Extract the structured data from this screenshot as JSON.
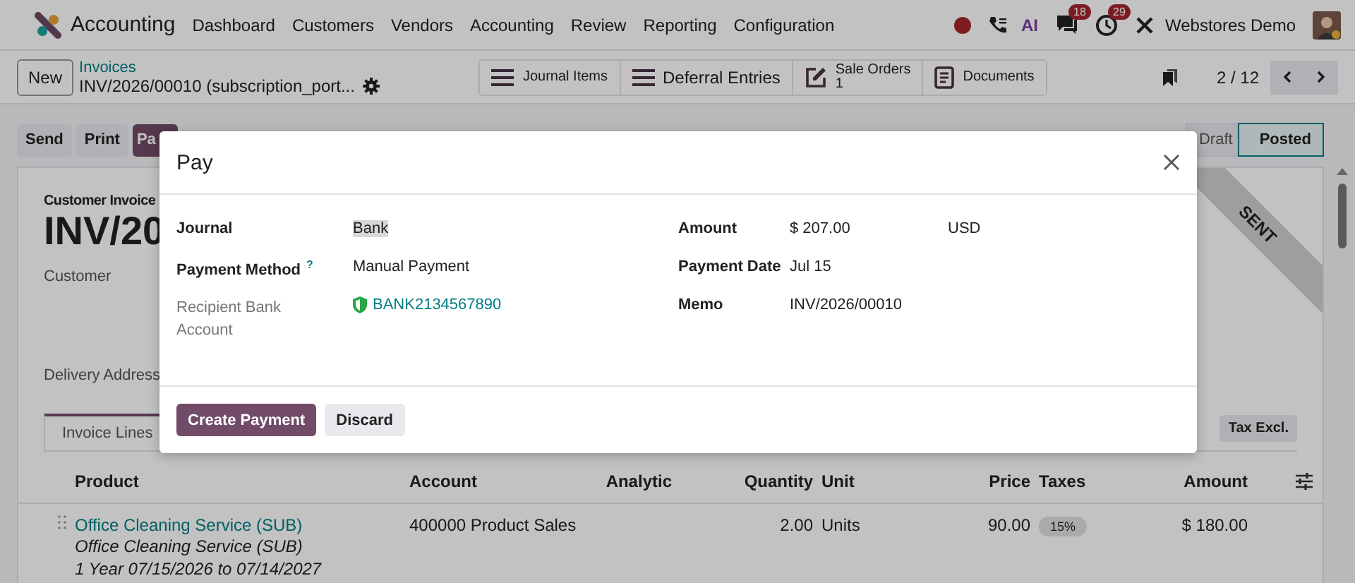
{
  "app": {
    "name": "Accounting"
  },
  "menu": [
    "Dashboard",
    "Customers",
    "Vendors",
    "Accounting",
    "Review",
    "Reporting",
    "Configuration"
  ],
  "systray": {
    "ai_label": "AI",
    "messages_count": "18",
    "activities_count": "29",
    "company": "Webstores Demo"
  },
  "control_panel": {
    "new_label": "New",
    "breadcrumb": "Invoices",
    "record": "INV/2026/00010 (subscription_port...",
    "smart_buttons": [
      {
        "kind": "list",
        "label": "Journal Items",
        "small": true
      },
      {
        "kind": "list",
        "label": "Deferral Entries",
        "small": false
      },
      {
        "kind": "edit",
        "label": "Sale Orders",
        "count": "1",
        "small": true
      },
      {
        "kind": "doc",
        "label": "Documents",
        "small": true
      }
    ],
    "pager": "2 / 12"
  },
  "actions": [
    {
      "label": "Send",
      "primary": false
    },
    {
      "label": "Print",
      "primary": false
    },
    {
      "label": "Pa",
      "primary": true
    }
  ],
  "statusbar": [
    {
      "label": "Draft",
      "selected": false
    },
    {
      "label": "Posted",
      "selected": true
    }
  ],
  "form": {
    "type_label": "Customer Invoice",
    "name": "INV/20",
    "ribbon": "SENT",
    "customer_label": "Customer",
    "delivery_label": "Delivery Address",
    "tabs": [
      {
        "label": "Invoice Lines",
        "selected": true
      }
    ],
    "tax_button": "Tax Excl.",
    "columns": [
      {
        "label": "Product"
      },
      {
        "label": "Account"
      },
      {
        "label": "Analytic"
      },
      {
        "label": "Quantity"
      },
      {
        "label": "Unit"
      },
      {
        "label": "Price"
      },
      {
        "label": "Taxes"
      },
      {
        "label": "Amount"
      }
    ],
    "rows": [
      {
        "product": "Office Cleaning Service (SUB)",
        "description": [
          "Office Cleaning Service (SUB)",
          "1 Year 07/15/2026 to 07/14/2027"
        ],
        "account": "400000 Product Sales",
        "analytic": "",
        "quantity": "2.00",
        "unit": "Units",
        "price": "90.00",
        "taxes": [
          "15%"
        ],
        "amount": "$ 180.00"
      }
    ]
  },
  "dialog": {
    "title": "Pay",
    "left_fields": [
      {
        "label": "Journal",
        "value": "Bank",
        "kind": "highlighted",
        "muted": false
      },
      {
        "label": "Payment Method",
        "help": "?",
        "value": "Manual Payment",
        "kind": "text",
        "muted": false
      },
      {
        "label": "Recipient Bank Account",
        "value": "BANK2134567890",
        "kind": "bank_link",
        "muted": true
      }
    ],
    "right_fields": [
      {
        "label": "Amount",
        "value": "$ 207.00",
        "currency": "USD"
      },
      {
        "label": "Payment Date",
        "value": "Jul 15"
      },
      {
        "label": "Memo",
        "value": "INV/2026/00010"
      }
    ],
    "buttons": [
      {
        "label": "Create Payment",
        "primary": true
      },
      {
        "label": "Discard",
        "primary": false
      }
    ]
  }
}
